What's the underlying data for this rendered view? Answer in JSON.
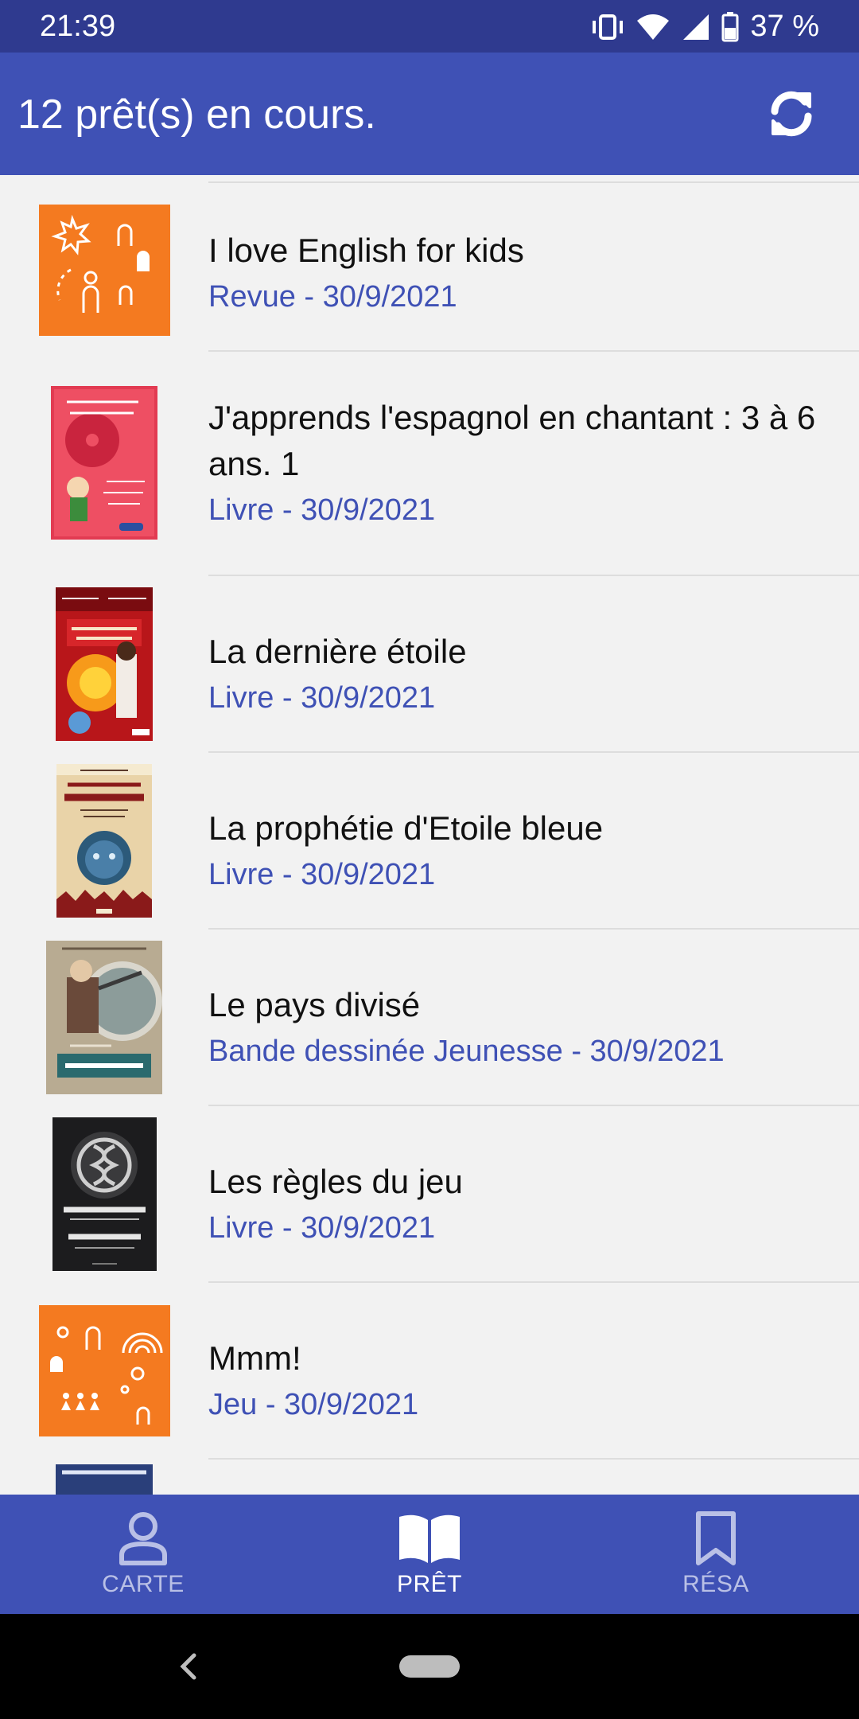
{
  "status_bar": {
    "time": "21:39",
    "battery": "37 %"
  },
  "app_bar": {
    "title": "12 prêt(s) en cours.",
    "refresh_icon": "refresh-icon"
  },
  "loans": [
    {
      "title": "I love English for kids",
      "subtitle": "Revue - 30/9/2021",
      "cover": "placeholder-orange"
    },
    {
      "title": "J'apprends l'espagnol en chantant : 3 à 6 ans. 1",
      "subtitle": "Livre - 30/9/2021",
      "cover": "red-cd-book"
    },
    {
      "title": "La dernière étoile",
      "subtitle": "Livre - 30/9/2021",
      "cover": "oksa-pollock"
    },
    {
      "title": "La prophétie d'Etoile bleue",
      "subtitle": "Livre - 30/9/2021",
      "cover": "guerre-des-clans"
    },
    {
      "title": "Le pays divisé",
      "subtitle": "Bande dessinée Jeunesse - 30/9/2021",
      "cover": "resistance-comic"
    },
    {
      "title": "Les règles du jeu",
      "subtitle": "Livre - 30/9/2021",
      "cover": "endgame"
    },
    {
      "title": "Mmm!",
      "subtitle": "Jeu - 30/9/2021",
      "cover": "placeholder-orange"
    }
  ],
  "bottom_nav": [
    {
      "label": "CARTE",
      "icon": "person-icon",
      "active": false
    },
    {
      "label": "PRÊT",
      "icon": "open-book-icon",
      "active": true
    },
    {
      "label": "RÉSA",
      "icon": "bookmark-icon",
      "active": false
    }
  ],
  "colors": {
    "primary": "#3f51b5",
    "primary_dark": "#2f3a8f",
    "accent_orange": "#f47a20",
    "list_bg": "#f2f2f2"
  }
}
